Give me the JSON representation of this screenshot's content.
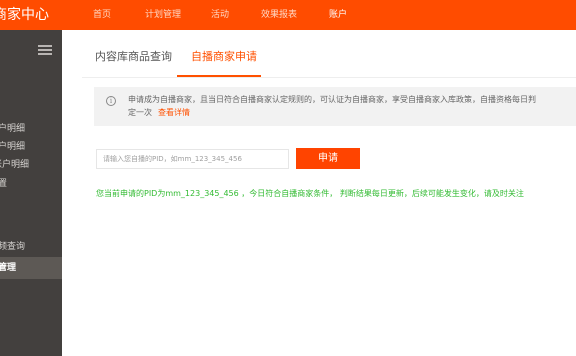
{
  "brand": "商家中心",
  "nav": [
    "首页",
    "计划管理",
    "活动",
    "效果报表",
    "账户"
  ],
  "sidebar": {
    "items": [
      "户明细",
      "户明细",
      "账户明细",
      "置",
      "频查询",
      "管理"
    ]
  },
  "tabs": [
    "内容库商品查询",
    "自播商家申请"
  ],
  "notice": {
    "text_line1": "申请成为自播商家，且当日符合自播商家认定规则的，可认证为自播商家，享受自播商家入库政策，自播资格每日判",
    "text_line2": "定一次",
    "link": "查看详情"
  },
  "form": {
    "placeholder": "请输入您自播的PID，如mm_123_345_456",
    "button": "申请"
  },
  "result": "您当前申请的PID为mm_123_345_456 ，今日符合自播商家条件， 判断结果每日更新，后续可能发生变化，请及时关注",
  "colors": {
    "topbar": "#ff4c00",
    "sidebar": "#43403e",
    "accent": "#ff5000",
    "success": "#33bb33"
  }
}
